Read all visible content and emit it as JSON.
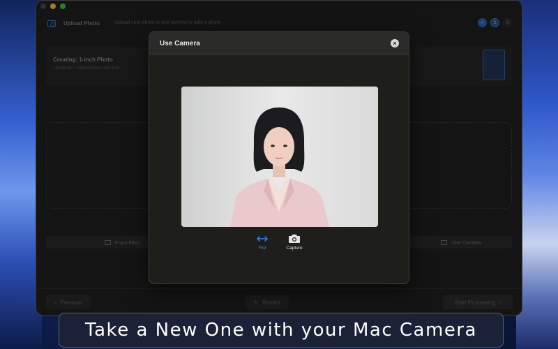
{
  "window": {
    "step_title": "Upload Photo",
    "step_separator": "-",
    "step_description": "Upload your photo or use camera to take a photo",
    "steps": [
      {
        "label": "✓",
        "state": "done"
      },
      {
        "label": "2",
        "state": "active"
      },
      {
        "label": "3",
        "state": "todo"
      }
    ]
  },
  "info_card": {
    "title": "Creating: 1-inch Photo",
    "subtitle": "25x35mm • 295x413px • 300 DPI"
  },
  "source_buttons": {
    "from_files": "From Files",
    "use_camera": "Use Camera"
  },
  "footer": {
    "previous": "Previous",
    "restart": "Restart",
    "start_processing": "Start Processing"
  },
  "modal": {
    "title": "Use Camera",
    "tools": {
      "flip": "Flip",
      "capture": "Capture"
    }
  },
  "caption": "Take a New One with your Mac Camera",
  "colors": {
    "accent_blue": "#3b82e8",
    "window_bg": "#202020",
    "modal_bg": "#1e1e1a"
  },
  "icons": {
    "app": "camera-icon",
    "flip": "flip-horizontal-icon",
    "capture": "camera-icon",
    "close": "close-icon",
    "folder": "folder-icon",
    "restart": "restart-icon"
  }
}
